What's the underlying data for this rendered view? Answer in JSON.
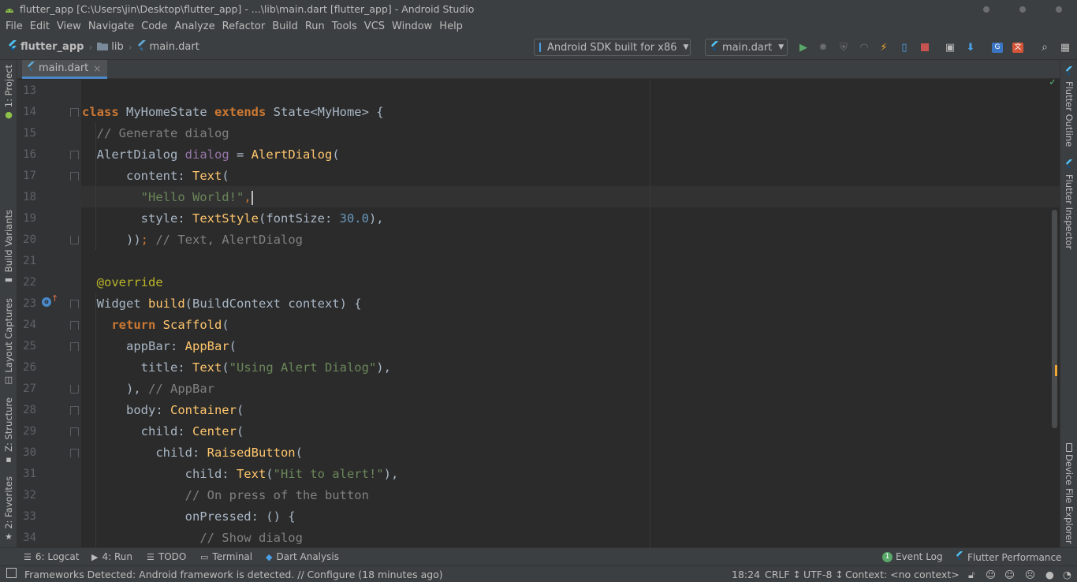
{
  "window": {
    "title": "flutter_app [C:\\Users\\jin\\Desktop\\flutter_app] - ...\\lib\\main.dart [flutter_app] - Android Studio"
  },
  "menu": [
    "File",
    "Edit",
    "View",
    "Navigate",
    "Code",
    "Analyze",
    "Refactor",
    "Build",
    "Run",
    "Tools",
    "VCS",
    "Window",
    "Help"
  ],
  "breadcrumb": {
    "project": "flutter_app",
    "folder": "lib",
    "file": "main.dart"
  },
  "toolbar": {
    "device": "Android SDK built for x86",
    "run_config": "main.dart"
  },
  "tabs": [
    {
      "label": "main.dart",
      "close": "×"
    }
  ],
  "left_tools": {
    "project": "1: Project",
    "build_variants": "Build Variants",
    "layout_captures": "Layout Captures",
    "structure": "Z: Structure",
    "favorites": "2: Favorites"
  },
  "right_tools": {
    "flutter_outline": "Flutter Outline",
    "flutter_inspector": "Flutter Inspector",
    "device_file_explorer": "Device File Explorer"
  },
  "editor": {
    "line_numbers": [
      "13",
      "14",
      "15",
      "16",
      "17",
      "18",
      "19",
      "20",
      "21",
      "22",
      "23",
      "24",
      "25",
      "26",
      "27",
      "28",
      "29",
      "30",
      "31",
      "32",
      "33",
      "34"
    ]
  },
  "bottom_tools": {
    "logcat": "6: Logcat",
    "run": "4: Run",
    "todo": "TODO",
    "terminal": "Terminal",
    "dart_analysis": "Dart Analysis",
    "event_log": "Event Log",
    "event_log_count": "1",
    "flutter_performance": "Flutter Performance"
  },
  "status": {
    "message": "Frameworks Detected: Android framework is detected. // Configure (18 minutes ago)",
    "position": "18:24",
    "line_sep": "CRLF ↕",
    "encoding": "UTF-8 ↕",
    "context": "Context: <no context>"
  },
  "colors": {
    "background": "#2b2b2b",
    "chrome": "#3c3f41",
    "keyword": "#cc7832",
    "string": "#6a8759",
    "function": "#ffc66d",
    "comment": "#808080",
    "number": "#6897bb"
  }
}
